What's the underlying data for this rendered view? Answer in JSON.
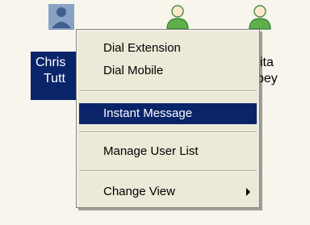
{
  "users": [
    {
      "name_lines": [
        "Chris",
        "Tutt"
      ],
      "selected": true,
      "avatar_icon": "user-avatar-generic-icon"
    },
    {
      "name_lines": [],
      "selected": false,
      "avatar_icon": "user-avatar-green-icon"
    },
    {
      "name_lines": [
        "ita",
        "bey"
      ],
      "selected": false,
      "avatar_icon": "user-avatar-green-icon"
    }
  ],
  "menu": {
    "items": [
      {
        "label": "Dial Extension"
      },
      {
        "label": "Dial Mobile"
      },
      {
        "label": "Instant Message",
        "highlighted": true
      },
      {
        "label": "Manage User List"
      },
      {
        "label": "Change View",
        "submenu": true
      }
    ]
  },
  "colors": {
    "background": "#f7f5ec",
    "selection": "#0a246a",
    "menu_bg": "#ece9d8",
    "avatar_green": "#5fb04a"
  }
}
